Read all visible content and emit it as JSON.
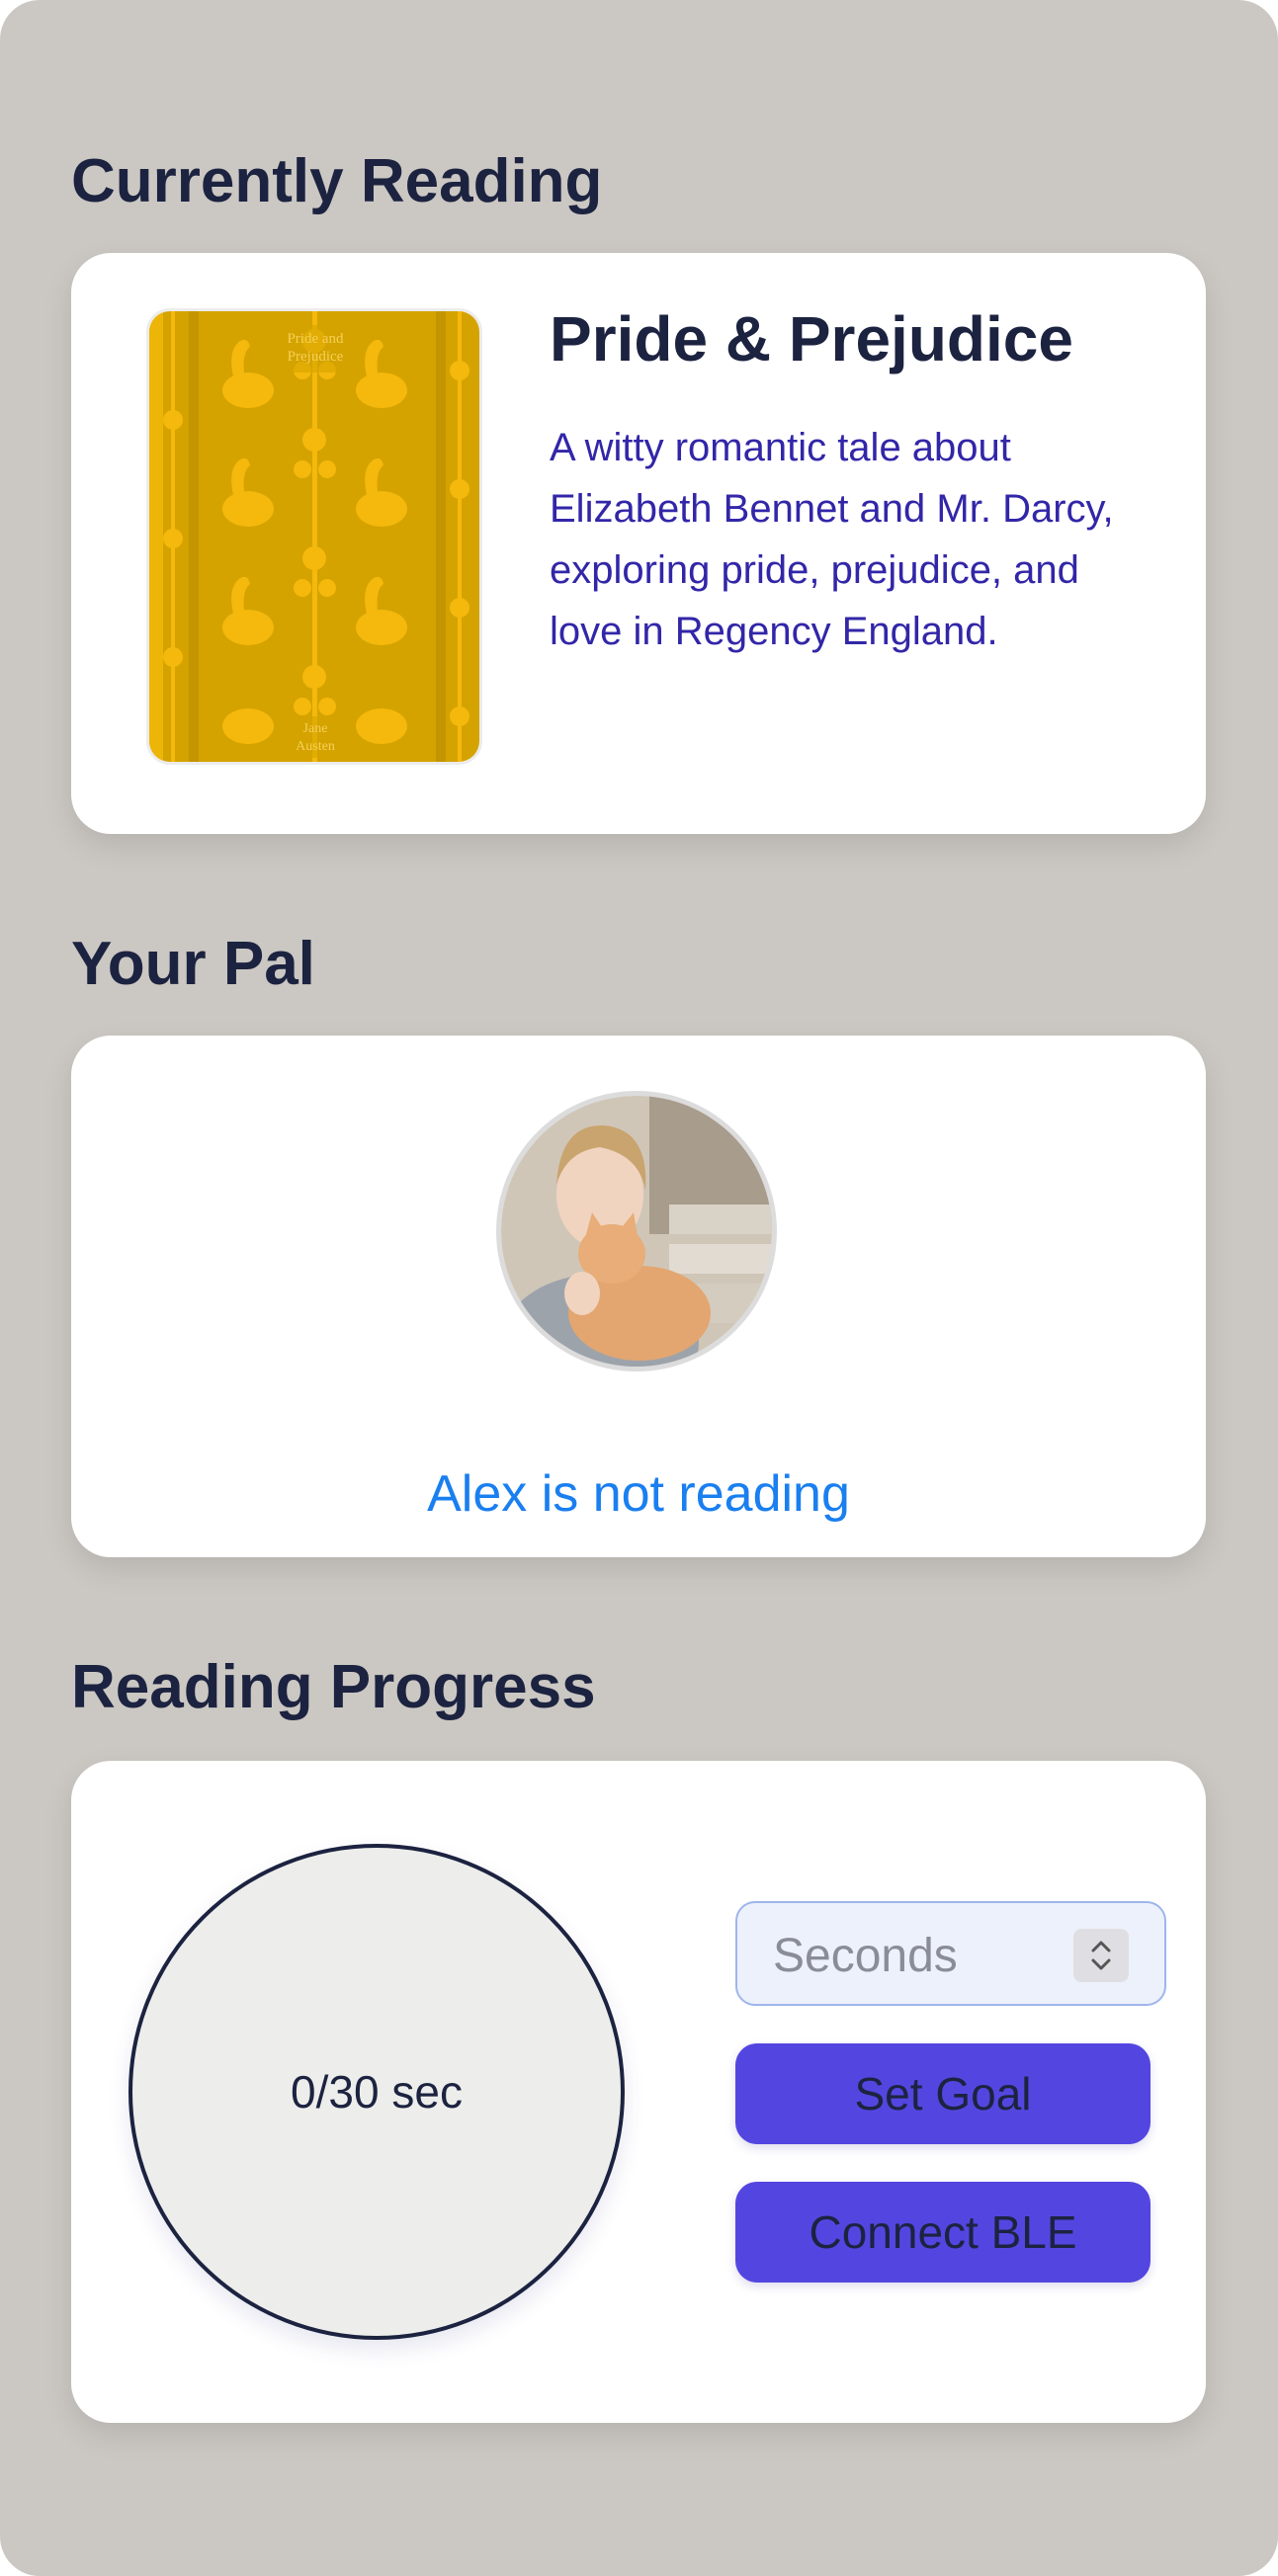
{
  "currently_reading": {
    "heading": "Currently Reading",
    "book": {
      "title": "Pride & Prejudice",
      "description": "A witty romantic tale about Elizabeth Bennet and Mr. Darcy, exploring pride, prejudice, and love in Regency England.",
      "cover": {
        "title_text": "Pride and Prejudice",
        "author_text": "Jane Austen",
        "color": "#d4a300",
        "pattern_color": "#f2b90a"
      }
    }
  },
  "pal": {
    "heading": "Your Pal",
    "avatar_description_icon": "woman-with-cat-photo",
    "status": "Alex is not reading"
  },
  "reading_progress": {
    "heading": "Reading Progress",
    "progress_text": "0/30 sec",
    "unit_select": {
      "selected": "Seconds"
    },
    "set_goal_label": "Set Goal",
    "connect_ble_label": "Connect BLE"
  },
  "colors": {
    "background": "#cbc7c2",
    "heading": "#1c2340",
    "description": "#3226a8",
    "status": "#1a7ff0",
    "button": "#5346e0"
  }
}
